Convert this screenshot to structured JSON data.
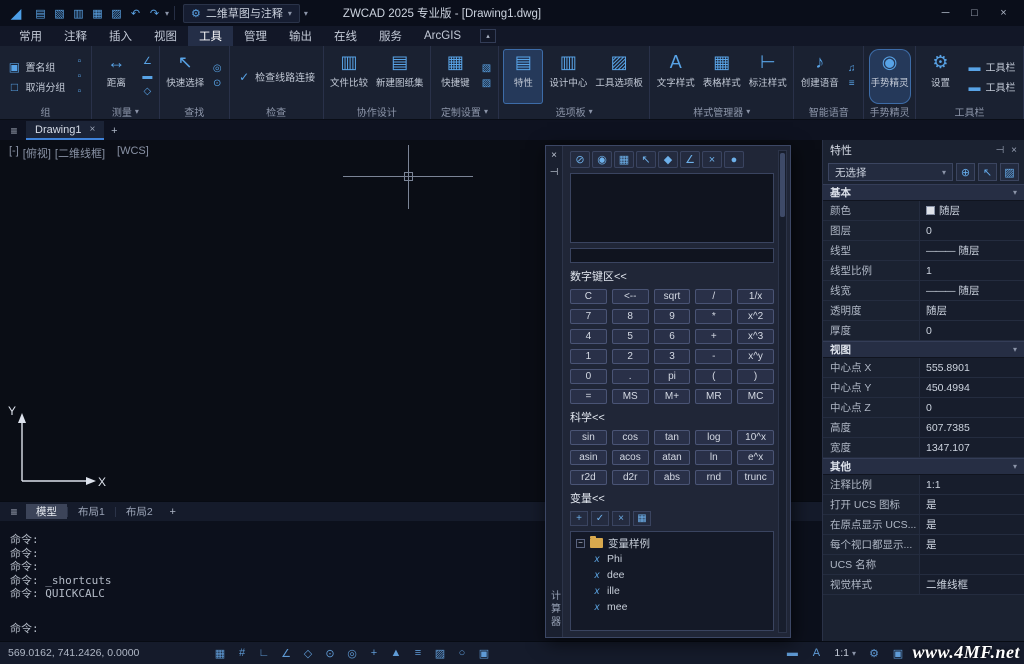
{
  "icons": {
    "menu": "≡",
    "caret_down": "▾",
    "collapse_up": "▴",
    "gear": "⚙",
    "logo": "◢"
  },
  "titlebar": {
    "title": "ZWCAD 2025 专业版 - [Drawing1.dwg]",
    "workspace": "二维草图与注释",
    "quick_access": [
      {
        "name": "new-file-icon",
        "glyph": "▤"
      },
      {
        "name": "open-file-icon",
        "glyph": "▧"
      },
      {
        "name": "save-icon",
        "glyph": "▥"
      },
      {
        "name": "save-as-icon",
        "glyph": "▦"
      },
      {
        "name": "print-icon",
        "glyph": "▨"
      },
      {
        "name": "undo-icon",
        "glyph": "↶"
      },
      {
        "name": "redo-icon",
        "glyph": "↷"
      }
    ],
    "window_controls": [
      {
        "name": "minimize-button",
        "glyph": "─"
      },
      {
        "name": "maximize-button",
        "glyph": "□"
      },
      {
        "name": "close-button",
        "glyph": "×"
      }
    ]
  },
  "menubar": {
    "active": "tools",
    "tabs": [
      {
        "id": "home",
        "label": "常用"
      },
      {
        "id": "annotate",
        "label": "注释"
      },
      {
        "id": "insert",
        "label": "插入"
      },
      {
        "id": "view",
        "label": "视图"
      },
      {
        "id": "tools",
        "label": "工具"
      },
      {
        "id": "manage",
        "label": "管理"
      },
      {
        "id": "output",
        "label": "输出"
      },
      {
        "id": "online",
        "label": "在线"
      },
      {
        "id": "service",
        "label": "服务"
      },
      {
        "id": "arcgis",
        "label": "ArcGIS"
      }
    ]
  },
  "ribbon": {
    "groups": [
      {
        "id": "group",
        "label": "组",
        "type": "stack",
        "buttons": [
          {
            "label": "置名组",
            "glyph": "▣",
            "name": "named-group-button"
          },
          {
            "label": "取消分组",
            "glyph": "□",
            "name": "ungroup-button"
          }
        ],
        "minis": [
          "▫",
          "▫",
          "▫"
        ]
      },
      {
        "id": "measure",
        "label": "测量",
        "dropdown": true,
        "type": "large",
        "buttons": [
          {
            "label": "距离",
            "glyph": "↔",
            "name": "distance-button"
          }
        ],
        "minis": [
          "∠",
          "▬",
          "◇"
        ]
      },
      {
        "id": "find",
        "label": "查找",
        "type": "large",
        "buttons": [
          {
            "label": "快速选择",
            "glyph": "↖",
            "name": "quick-select-button"
          }
        ],
        "minis": [
          "◎",
          "⊙"
        ]
      },
      {
        "id": "check",
        "label": "检查",
        "type": "wide",
        "buttons": [
          {
            "label": "检查线路连接",
            "glyph": "✓",
            "name": "check-circuit-button"
          }
        ]
      },
      {
        "id": "collaboration",
        "label": "协作设计",
        "type": "large",
        "buttons": [
          {
            "label": "文件比较",
            "glyph": "▥",
            "name": "file-compare-button"
          },
          {
            "label": "新建图纸集",
            "glyph": "▤",
            "name": "new-sheet-set-button"
          }
        ]
      },
      {
        "id": "customization",
        "label": "定制设置",
        "dropdown": true,
        "type": "large",
        "buttons": [
          {
            "label": "快捷键",
            "glyph": "▦",
            "name": "shortcut-keys-button"
          }
        ],
        "minis": [
          "▧",
          "▨"
        ]
      },
      {
        "id": "palettes",
        "label": "选项板",
        "dropdown": true,
        "type": "large",
        "buttons": [
          {
            "label": "特性",
            "glyph": "▤",
            "name": "properties-button",
            "active": true
          },
          {
            "label": "设计中心",
            "glyph": "▥",
            "name": "design-center-button"
          },
          {
            "label": "工具选项板",
            "glyph": "▨",
            "name": "tool-palettes-button"
          }
        ]
      },
      {
        "id": "style-manager",
        "label": "样式管理器",
        "dropdown": true,
        "type": "large",
        "buttons": [
          {
            "label": "文字样式",
            "glyph": "A",
            "name": "text-style-button"
          },
          {
            "label": "表格样式",
            "glyph": "▦",
            "name": "table-style-button"
          },
          {
            "label": "标注样式",
            "glyph": "⊢",
            "name": "dim-style-button"
          }
        ]
      },
      {
        "id": "smart-voice",
        "label": "智能语音",
        "type": "large",
        "buttons": [
          {
            "label": "创建语音",
            "glyph": "♪",
            "name": "create-voice-button"
          }
        ],
        "minis": [
          "♫",
          "≡"
        ]
      },
      {
        "id": "gesture",
        "label": "手势精灵",
        "type": "large",
        "buttons": [
          {
            "label": "手势精灵",
            "glyph": "◉",
            "name": "gesture-sprite-button",
            "active": true,
            "pill": true
          }
        ]
      },
      {
        "id": "toolbars",
        "label": "工具栏",
        "type": "large",
        "buttons": [
          {
            "label": "设置",
            "glyph": "⚙",
            "name": "settings-button"
          }
        ],
        "stacked": [
          {
            "label": "工具栏",
            "glyph": "▬",
            "name": "toolbar-button-a"
          },
          {
            "label": "工具栏",
            "glyph": "▬",
            "name": "toolbar-button-b"
          }
        ]
      }
    ]
  },
  "doc_tabs": {
    "active_tab": "Drawing1",
    "close_glyph": "×",
    "new_tab_glyph": "+"
  },
  "canvas": {
    "viewport_controls": [
      {
        "id": "viewport-menu",
        "label": "[-]"
      },
      {
        "id": "viewport-view",
        "label": "[俯视]"
      },
      {
        "id": "viewport-visual-style",
        "label": "[二维线框]"
      }
    ],
    "wcs_label": "[WCS]",
    "ucs": {
      "x_label": "X",
      "y_label": "Y"
    }
  },
  "calculator": {
    "rail_title": "计算器",
    "close_glyph": "×",
    "autohide_glyph": "⊣",
    "toolbar": [
      {
        "name": "clear-icon",
        "glyph": "⊘"
      },
      {
        "name": "clear-history-icon",
        "glyph": "◉"
      },
      {
        "name": "paste-to-command-icon",
        "glyph": "▦"
      },
      {
        "name": "get-coordinates-icon",
        "glyph": "↖"
      },
      {
        "name": "distance-between-points-icon",
        "glyph": "◆"
      },
      {
        "name": "angle-of-line-icon",
        "glyph": "∠"
      },
      {
        "name": "intersection-icon",
        "glyph": "×"
      },
      {
        "name": "help-icon",
        "glyph": "●"
      }
    ],
    "sections": {
      "numpad": "数字键区<<",
      "scientific": "科学<<",
      "variables": "变量<<"
    },
    "numpad": [
      [
        "C",
        "<--",
        "sqrt",
        "/",
        "1/x"
      ],
      [
        "7",
        "8",
        "9",
        "*",
        "x^2"
      ],
      [
        "4",
        "5",
        "6",
        "+",
        "x^3"
      ],
      [
        "1",
        "2",
        "3",
        "-",
        "x^y"
      ],
      [
        "0",
        ".",
        "pi",
        "(",
        ")"
      ],
      [
        "=",
        "MS",
        "M+",
        "MR",
        "MC"
      ]
    ],
    "scientific": [
      [
        "sin",
        "cos",
        "tan",
        "log",
        "10^x"
      ],
      [
        "asin",
        "acos",
        "atan",
        "ln",
        "e^x"
      ],
      [
        "r2d",
        "d2r",
        "abs",
        "rnd",
        "trunc"
      ]
    ],
    "vars_toolbar": [
      {
        "name": "new-variable-icon",
        "glyph": "+"
      },
      {
        "name": "edit-variable-icon",
        "glyph": "✓"
      },
      {
        "name": "delete-variable-icon",
        "glyph": "×"
      },
      {
        "name": "return-variable-icon",
        "glyph": "▦"
      }
    ],
    "tree": {
      "expander_glyph": "−",
      "folder": "变量样例",
      "items": [
        {
          "glyph": "x",
          "label": "Phi"
        },
        {
          "glyph": "x",
          "label": "dee"
        },
        {
          "glyph": "x",
          "label": "ille"
        },
        {
          "glyph": "x",
          "label": "mee"
        }
      ]
    }
  },
  "properties_panel": {
    "title": "特性",
    "autohide_glyph": "⊣",
    "close_glyph": "×",
    "selection": "无选择",
    "toolbar": [
      {
        "name": "toggle-pickadd-icon",
        "glyph": "⊕"
      },
      {
        "name": "select-objects-icon",
        "glyph": "↖"
      },
      {
        "name": "quick-select-icon",
        "glyph": "▨"
      }
    ],
    "sections": [
      {
        "id": "basic",
        "title": "基本",
        "rows": [
          {
            "label": "颜色",
            "value": "随层",
            "type": "swatch"
          },
          {
            "label": "图层",
            "value": "0"
          },
          {
            "label": "线型",
            "value": "随层",
            "type": "line"
          },
          {
            "label": "线型比例",
            "value": "1"
          },
          {
            "label": "线宽",
            "value": "随层",
            "type": "line"
          },
          {
            "label": "透明度",
            "value": "随层"
          },
          {
            "label": "厚度",
            "value": "0"
          }
        ]
      },
      {
        "id": "view",
        "title": "视图",
        "rows": [
          {
            "label": "中心点 X",
            "value": "555.8901"
          },
          {
            "label": "中心点 Y",
            "value": "450.4994"
          },
          {
            "label": "中心点 Z",
            "value": "0"
          },
          {
            "label": "高度",
            "value": "607.7385"
          },
          {
            "label": "宽度",
            "value": "1347.107"
          }
        ]
      },
      {
        "id": "other",
        "title": "其他",
        "rows": [
          {
            "label": "注释比例",
            "value": "1:1"
          },
          {
            "label": "打开 UCS 图标",
            "value": "是"
          },
          {
            "label": "在原点显示 UCS...",
            "value": "是"
          },
          {
            "label": "每个视口都显示...",
            "value": "是"
          },
          {
            "label": "UCS 名称",
            "value": ""
          },
          {
            "label": "视觉样式",
            "value": "二维线框"
          }
        ]
      }
    ]
  },
  "layout_tabs": {
    "active": "模型",
    "add_glyph": "+",
    "items": [
      {
        "id": "model",
        "label": "模型"
      },
      {
        "id": "layout1",
        "label": "布局1"
      },
      {
        "id": "layout2",
        "label": "布局2"
      }
    ]
  },
  "command": {
    "history": [
      "命令:",
      "命令:",
      "命令:",
      "命令: _shortcuts",
      "命令: QUICKCALC"
    ],
    "prompt": "命令:"
  },
  "statusbar": {
    "coordinates": "569.0162, 741.2426, 0.0000",
    "toggles": [
      {
        "name": "grid-toggle",
        "glyph": "▦"
      },
      {
        "name": "snap-toggle",
        "glyph": "#"
      },
      {
        "name": "ortho-toggle",
        "glyph": "∟"
      },
      {
        "name": "polar-toggle",
        "glyph": "∠"
      },
      {
        "name": "isometric-toggle",
        "glyph": "◇"
      },
      {
        "name": "osnap-toggle",
        "glyph": "⊙"
      },
      {
        "name": "osnap-3d-toggle",
        "glyph": "◎"
      },
      {
        "name": "otrack-toggle",
        "glyph": "+"
      },
      {
        "name": "dyn-toggle",
        "glyph": "▲"
      },
      {
        "name": "lineweight-toggle",
        "glyph": "≡"
      },
      {
        "name": "transparency-toggle",
        "glyph": "▨"
      },
      {
        "name": "cycling-toggle",
        "glyph": "○"
      },
      {
        "name": "quick-properties-toggle",
        "glyph": "▣"
      }
    ],
    "right_icons": [
      {
        "name": "model-space-icon",
        "glyph": "▬"
      },
      {
        "name": "annotation-visibility-icon",
        "glyph": "A"
      }
    ],
    "scale": "1:1",
    "right_icons_after": [
      {
        "name": "workspace-gear-icon",
        "glyph": "⚙"
      },
      {
        "name": "display-settings-icon",
        "glyph": "▣"
      }
    ],
    "watermark": "www.4MF.net"
  }
}
